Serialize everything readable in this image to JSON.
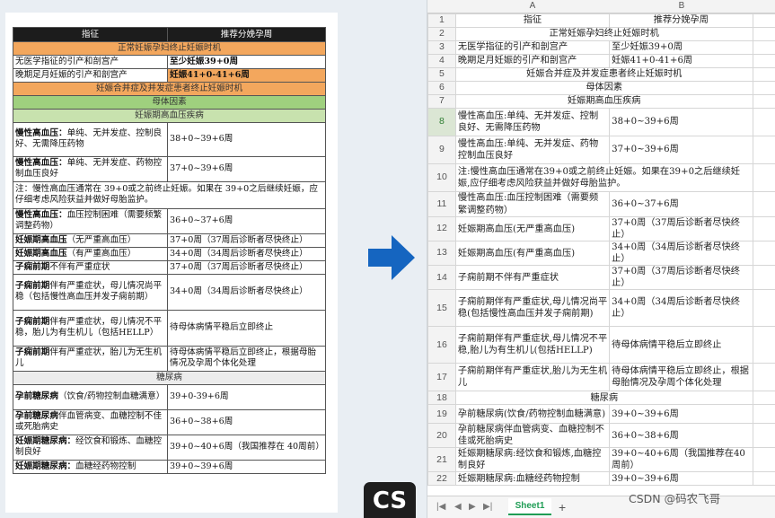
{
  "doc": {
    "header": [
      "指征",
      "推荐分娩孕周"
    ],
    "sec1": "正常妊娠孕妇终止妊娠时机",
    "r1": [
      "无医学指征的引产和剖宫产",
      "至少妊娠39+0周"
    ],
    "r2": [
      "晚期足月妊娠的引产和剖宫产",
      "妊娠41+0-41+6周"
    ],
    "sec2": "妊娠合并症及并发症患者终止妊娠时机",
    "sec3": "母体因素",
    "sec4": "妊娠期高血压疾病",
    "r5a": "慢性高血压：",
    "r5b": "单纯、无并发症、控制良好、无需降压药物",
    "r5c": "38+0~39+6周",
    "r6a": "慢性高血压：",
    "r6b": "单纯、无并发症、药物控制血压良好",
    "r6c": "37+0~39+6周",
    "note": "注：慢性高血压通常在 39+0或之前终止妊娠。如果在 39+0之后继续妊娠，应仔细考虑风险获益并做好母胎监护。",
    "r8a": "慢性高血压：",
    "r8b": "血压控制困难（需要频繁调整药物）",
    "r8c": "36+0~37+6周",
    "r9a": "妊娠期高血压",
    "r9b": "（无严重高血压）",
    "r9c": "37+0周（37周后诊断者尽快终止）",
    "r10a": "妊娠期高血压",
    "r10b": "（有严重高血压）",
    "r10c": "34+0周（34周后诊断者尽快终止）",
    "r11a": "子痫前期",
    "r11b": "不伴有严重症状",
    "r11c": "37+0周（37周后诊断者尽快终止）",
    "r12a": "子痫前期",
    "r12b": "伴有严重症状，母儿情况尚平稳（包括慢性高血压并发子痫前期）",
    "r12c": "34+0周（34周后诊断者尽快终止）",
    "r13a": "子痫前期",
    "r13b": "伴有严重症状，母儿情况不平稳，胎儿为有生机儿（包括HELLP）",
    "r13c": "待母体病情平稳后立即终止",
    "r14a": "子痫前期",
    "r14b": "伴有严重症状，胎儿为无生机儿",
    "r14c": "待母体病情平稳后立即终止，根据母胎情况及孕周个体化处理",
    "sec5": "糖尿病",
    "r16a": "孕前糖尿病",
    "r16b": "（饮食/药物控制血糖满意）",
    "r16c": "39+0-39+6周",
    "r17a": "孕前糖尿病",
    "r17b": "伴血管病变、血糖控制不佳或死胎病史",
    "r17c": "36+0~38+6周",
    "r18a": "妊娠期糖尿病：",
    "r18b": "经饮食和锻炼、血糖控制良好",
    "r18c": "39+0~40+6周（我国推荐在 40周前）",
    "r19a": "妊娠期糖尿病：",
    "r19b": "血糖经药物控制",
    "r19c": "39+0~39+6周"
  },
  "sheet": {
    "col_a": "A",
    "col_b": "B",
    "rows": [
      {
        "n": "1",
        "a": "指征",
        "b": "推荐分娩孕周"
      },
      {
        "n": "2",
        "merged": "正常妊娠孕妇终止妊娠时机"
      },
      {
        "n": "3",
        "a": "无医学指征的引产和剖宫产",
        "b": "至少妊娠39+0周"
      },
      {
        "n": "4",
        "a": "晚期足月妊娠的引产和剖宫产",
        "b": "妊娠41+0-41+6周"
      },
      {
        "n": "5",
        "merged": "妊娠合并症及并发症患者终止妊娠时机"
      },
      {
        "n": "6",
        "merged": "母体因素"
      },
      {
        "n": "7",
        "merged": "妊娠期高血压疾病"
      },
      {
        "n": "8",
        "a": "慢性高血压:单纯、无并发症、控制良好、无需降压药物",
        "b": "38+0~39+6周"
      },
      {
        "n": "9",
        "a": "慢性高血压:单纯、无并发症、药物控制血压良好",
        "b": "37+0~39+6周"
      },
      {
        "n": "10",
        "merged": "注:慢性高血压通常在39+0或之前终止妊娠。如果在39+0之后继续妊娠,应仔细考虑风险获益并做好母胎监护。"
      },
      {
        "n": "11",
        "a": "慢性高血压:血压控制困难（需要频繁调整药物）",
        "b": "36+0~37+6周"
      },
      {
        "n": "12",
        "a": "妊娠期高血压(无严重高血压)",
        "b": "37+0周（37周后诊断者尽快终止）"
      },
      {
        "n": "13",
        "a": "妊娠期高血压(有严重高血压)",
        "b": "34+0周（34周后诊断者尽快终止）"
      },
      {
        "n": "14",
        "a": "子痫前期不伴有严重症状",
        "b": "37+0周（37周后诊断者尽快终止）"
      },
      {
        "n": "15",
        "a": "子痫前期伴有严重症状,母儿情况尚平稳(包括慢性高血压并发子痫前期)",
        "b": "34+0周（34周后诊断者尽快终止）"
      },
      {
        "n": "16",
        "a": "子痫前期伴有严重症状,母儿情况不平稳,胎儿为有生机儿(包括HELLP)",
        "b": "待母体病情平稳后立即终止"
      },
      {
        "n": "17",
        "a": "子痫前期伴有严重症状,胎儿为无生机儿",
        "b": "待母体病情平稳后立即终止，根据母胎情况及孕周个体化处理"
      },
      {
        "n": "18",
        "merged": "糖尿病"
      },
      {
        "n": "19",
        "a": "孕前糖尿病(饮食/药物控制血糖满意)",
        "b": "39+0~39+6周"
      },
      {
        "n": "20",
        "a": "孕前糖尿病伴血管病变、血糖控制不佳或死胎病史",
        "b": "36+0~38+6周"
      },
      {
        "n": "21",
        "a": "妊娠期糖尿病:经饮食和锻炼,血糖控制良好",
        "b": "39+0~40+6周（我国推荐在40周前）"
      },
      {
        "n": "22",
        "a": "妊娠期糖尿病:血糖经药物控制",
        "b": "39+0~39+6周"
      }
    ],
    "selected_row": "8",
    "tab_label": "Sheet1",
    "add_sheet": "+"
  },
  "watermark": "CSDN @码农飞哥",
  "logo_text": "CS",
  "colors": {
    "arrow": "#1565c0",
    "orange": "#f3a75d",
    "green": "#9fd07e",
    "accent": "#1f9d55"
  }
}
